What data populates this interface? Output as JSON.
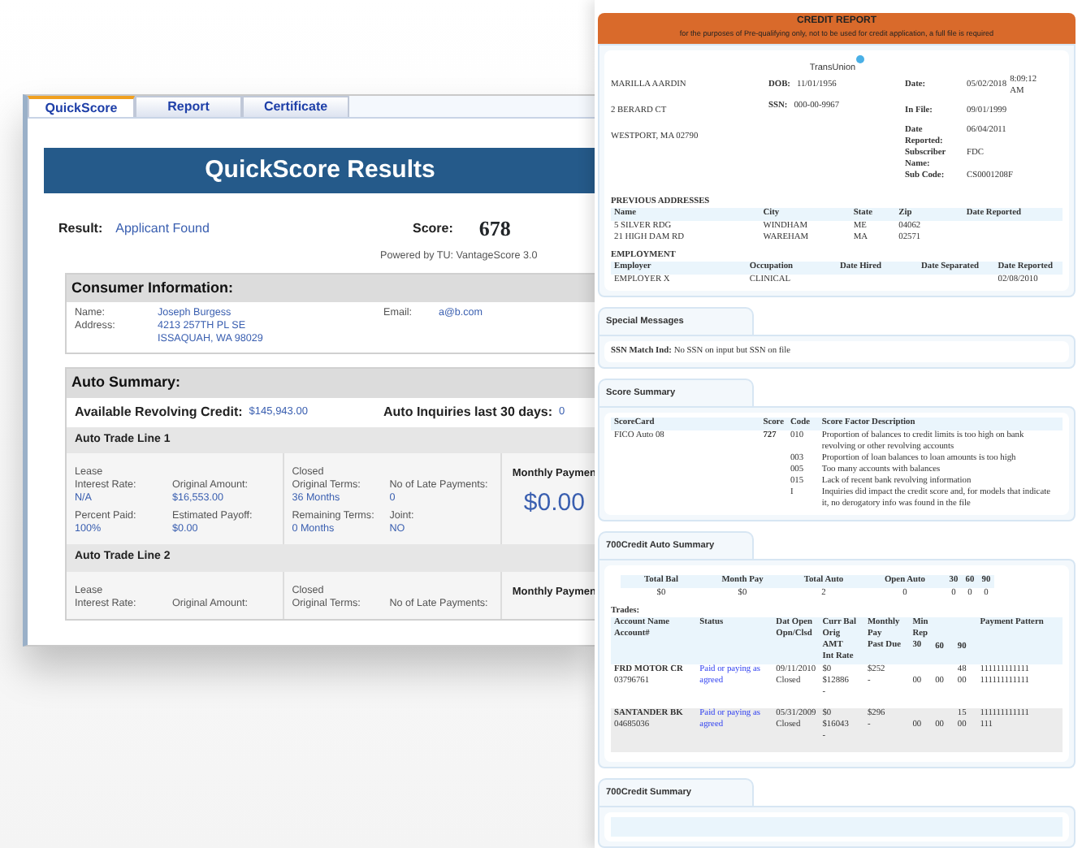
{
  "quickscore_window": {
    "tabs": [
      {
        "label": "QuickScore",
        "selected": true
      },
      {
        "label": "Report",
        "selected": false
      },
      {
        "label": "Certificate",
        "selected": false
      }
    ],
    "banner": "QuickScore Results",
    "result": {
      "label": "Result:",
      "value": "Applicant Found"
    },
    "score": {
      "label": "Score:",
      "value": "678"
    },
    "powered_by": "Powered by TU: VantageScore 3.0",
    "consumer": {
      "heading": "Consumer Information:",
      "fields": [
        {
          "label": "Name:",
          "lines": [
            "Joseph Burgess"
          ]
        },
        {
          "label": "Address:",
          "lines": [
            "4213 257TH PL SE",
            "ISSAQUAH, WA 98029"
          ]
        }
      ],
      "email": {
        "label": "Email:",
        "value": "a@b.com"
      }
    },
    "auto_summary": {
      "heading": "Auto Summary:",
      "stats": [
        {
          "label": "Available Revolving Credit:",
          "value": "$145,943.00"
        },
        {
          "label": "Auto Inquiries last 30 days:",
          "value": "0"
        }
      ],
      "trade_lines": [
        {
          "title": "Auto Trade Line 1",
          "type": "Lease",
          "fields": [
            {
              "label": "Interest Rate:",
              "value": "N/A"
            },
            {
              "label": "Original Amount:",
              "value": "$16,553.00"
            },
            {
              "label": "Percent Paid:",
              "value": "100%"
            },
            {
              "label": "Estimated Payoff:",
              "value": "$0.00"
            }
          ],
          "status": "Closed",
          "terms": [
            {
              "label": "Original Terms:",
              "value": "36 Months"
            },
            {
              "label": "No of Late Payments:",
              "value": "0"
            },
            {
              "label": "Remaining Terms:",
              "value": "0 Months"
            },
            {
              "label": "Joint:",
              "value": "NO"
            }
          ],
          "payment_label": "Monthly Paymen",
          "payment": "$0.00"
        },
        {
          "title": "Auto Trade Line 2",
          "type": "Lease",
          "fields": [
            {
              "label": "Interest Rate:"
            },
            {
              "label": "Original Amount:"
            }
          ],
          "status": "Closed",
          "terms": [
            {
              "label": "Original Terms:"
            },
            {
              "label": "No of Late Payments:"
            }
          ],
          "payment_label": "Monthly Paymen"
        }
      ]
    }
  },
  "credit_report": {
    "header_title": "CREDIT REPORT",
    "header_subtitle": "for the purposes of Pre-qualifying only, not to be used for credit application, a full file is required",
    "bureau": "TransUnion",
    "consumer_lines": [
      "MARILLA AARDIN",
      "2 BERARD CT",
      "WESTPORT, MA 02790"
    ],
    "ids": [
      {
        "label": "DOB:",
        "value": "11/01/1956"
      },
      {
        "label": "SSN:",
        "value": "000-00-9967"
      }
    ],
    "details": [
      {
        "label": "Date:",
        "value": "05/02/2018",
        "extra": "8:09:12 AM"
      },
      {
        "label": "In File:",
        "value": "09/01/1999"
      },
      {
        "label": "Date Reported:",
        "value": "06/04/2011"
      },
      {
        "label": "Subscriber Name:",
        "value": "FDC"
      },
      {
        "label": "Sub Code:",
        "value": "CS0001208F"
      }
    ],
    "previous_addresses": {
      "heading": "PREVIOUS ADDRESSES",
      "columns": [
        "Name",
        "City",
        "State",
        "Zip",
        "Date Reported"
      ],
      "rows": [
        {
          "name": "5 SILVER RDG",
          "city": "WINDHAM",
          "state": "ME",
          "zip": "04062"
        },
        {
          "name": "21 HIGH DAM RD",
          "city": "WAREHAM",
          "state": "MA",
          "zip": "02571"
        }
      ]
    },
    "employment": {
      "heading": "EMPLOYMENT",
      "columns": [
        "Employer",
        "Occupation",
        "Date Hired",
        "Date Separated",
        "Date Reported"
      ],
      "rows": [
        {
          "employer": "EMPLOYER X",
          "occupation": "CLINICAL",
          "date_reported": "02/08/2010"
        }
      ]
    },
    "special_messages": {
      "title": "Special Messages",
      "label": "SSN Match Ind:",
      "text": "No SSN on input but SSN on file"
    },
    "score_summary": {
      "title": "Score Summary",
      "columns": [
        "ScoreCard",
        "Score",
        "Code",
        "Score Factor Description"
      ],
      "scorecard": "FICO Auto 08",
      "score": "727",
      "factors": [
        {
          "code": "010",
          "description": "Proportion of balances to credit limits is too high on bank revolving or other revolving accounts"
        },
        {
          "code": "003",
          "description": "Proportion of loan balances to loan amounts is too high"
        },
        {
          "code": "005",
          "description": "Too many accounts with balances"
        },
        {
          "code": "015",
          "description": "Lack of recent bank revolving information"
        },
        {
          "code": "I",
          "description": "Inquiries did impact the credit score and, for models that indicate it, no derogatory info was found in the file"
        }
      ]
    },
    "auto_summary": {
      "title": "700Credit Auto Summary",
      "totals": [
        {
          "label": "Total Bal",
          "value": "$0"
        },
        {
          "label": "Month Pay",
          "value": "$0"
        },
        {
          "label": "Total Auto",
          "value": "2"
        },
        {
          "label": "Open Auto",
          "value": "0"
        },
        {
          "label": "30",
          "value": "0"
        },
        {
          "label": "60",
          "value": "0"
        },
        {
          "label": "90",
          "value": "0"
        }
      ],
      "trades_label": "Trades:",
      "trade_columns": [
        [
          "Account Name",
          "Account#"
        ],
        [
          "Status"
        ],
        [
          "Dat Open",
          "Opn/Clsd"
        ],
        [
          "Curr Bal",
          "Orig AMT",
          "Int Rate"
        ],
        [
          "Monthly Pay",
          "Past Due"
        ],
        [
          "Min Rep",
          "30"
        ],
        [
          "60"
        ],
        [
          "90"
        ],
        [
          "Payment Pattern"
        ]
      ],
      "trades": [
        {
          "cells": [
            [
              "FRD MOTOR CR",
              "03796761"
            ],
            [
              "Paid or paying as agreed"
            ],
            [
              "09/11/2010",
              "Closed"
            ],
            [
              "$0",
              "$12886",
              "-"
            ],
            [
              "$252",
              "-"
            ],
            [
              "00"
            ],
            [
              "00"
            ],
            [
              "48",
              "00"
            ],
            [
              "111111111111",
              "111111111111"
            ]
          ]
        },
        {
          "cells": [
            [
              "SANTANDER BK",
              "04685036"
            ],
            [
              "Paid or paying as agreed"
            ],
            [
              "05/31/2009",
              "Closed"
            ],
            [
              "$0",
              "$16043",
              "-"
            ],
            [
              "$296",
              "-"
            ],
            [
              "00"
            ],
            [
              "00"
            ],
            [
              "15",
              "00"
            ],
            [
              "111111111111",
              "111"
            ]
          ]
        }
      ]
    },
    "credit_summary": {
      "title": "700Credit Summary"
    }
  }
}
